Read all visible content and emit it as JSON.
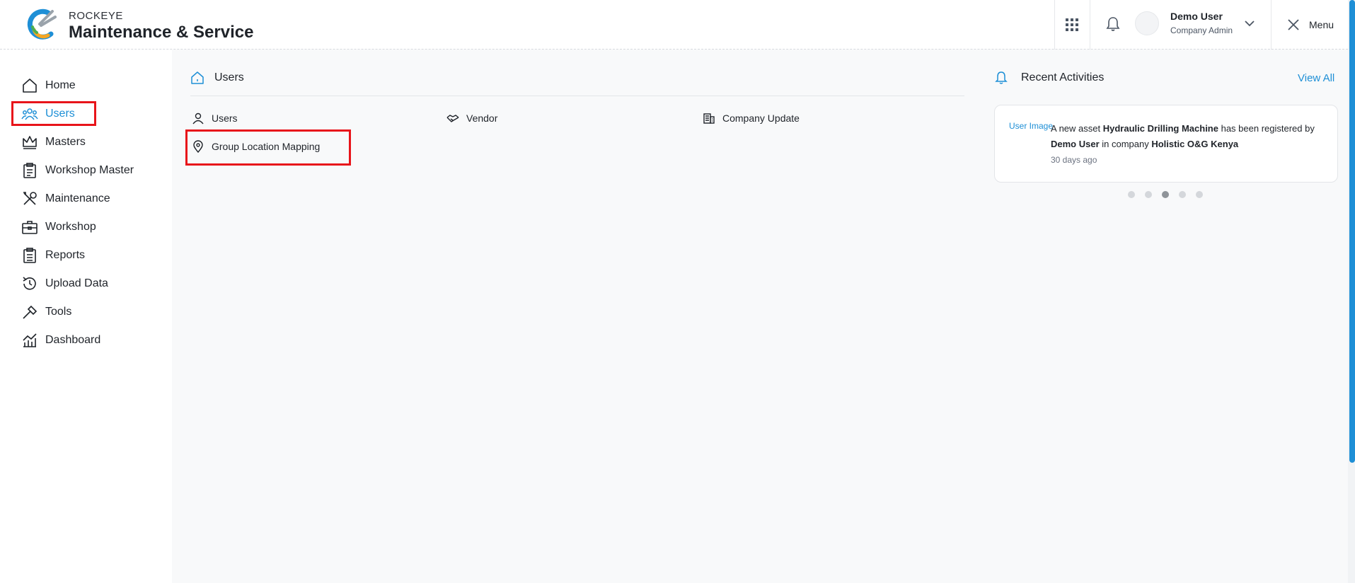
{
  "header": {
    "brand_small": "ROCKEYE",
    "brand_big": "Maintenance & Service",
    "user_name": "Demo User",
    "user_role": "Company Admin",
    "menu_label": "Menu"
  },
  "sidebar": {
    "items": [
      {
        "label": "Home",
        "icon": "home-icon"
      },
      {
        "label": "Users",
        "icon": "users-icon",
        "active": true
      },
      {
        "label": "Masters",
        "icon": "crown-icon"
      },
      {
        "label": "Workshop Master",
        "icon": "clipboard-icon"
      },
      {
        "label": "Maintenance",
        "icon": "tools-icon"
      },
      {
        "label": "Workshop",
        "icon": "briefcase-icon"
      },
      {
        "label": "Reports",
        "icon": "report-icon"
      },
      {
        "label": "Upload Data",
        "icon": "history-icon"
      },
      {
        "label": "Tools",
        "icon": "hammer-icon"
      },
      {
        "label": "Dashboard",
        "icon": "chart-icon"
      }
    ]
  },
  "breadcrumb": {
    "title": "Users"
  },
  "links": [
    {
      "label": "Users",
      "icon": "user-icon"
    },
    {
      "label": "Vendor",
      "icon": "handshake-icon"
    },
    {
      "label": "Company Update",
      "icon": "building-icon"
    },
    {
      "label": "Group Location Mapping",
      "icon": "location-pin-icon"
    }
  ],
  "recent": {
    "title": "Recent Activities",
    "view_all": "View All",
    "img_alt": "User Image",
    "text_1": "A new asset ",
    "asset": "Hydraulic Drilling Machine",
    "text_2": " has been registered by ",
    "user": "Demo User",
    "text_3": " in company ",
    "company": "Holistic O&G Kenya",
    "time": "30 days ago",
    "dots": 5,
    "active_dot": 3
  },
  "colors": {
    "accent": "#1e8fd6",
    "highlight": "#e8141a"
  }
}
